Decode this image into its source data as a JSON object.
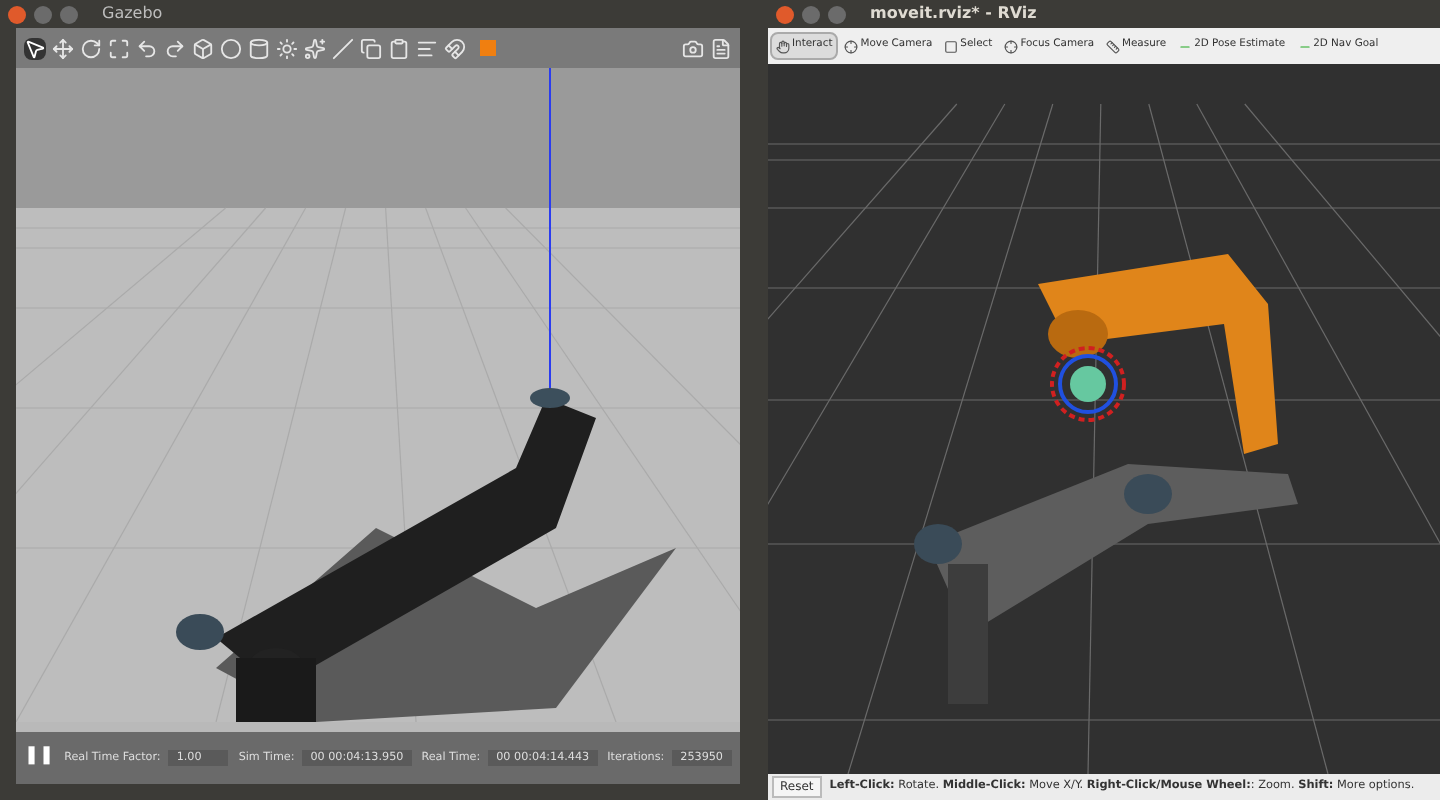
{
  "gazebo": {
    "window": {
      "title": "Gazebo"
    },
    "status_bar": {
      "pause": "❚❚",
      "fields": [
        {
          "label": "Real Time Factor:",
          "value": "1.00"
        },
        {
          "label": "Sim Time:",
          "value": "00 00:04:13.950"
        },
        {
          "label": "Real Time:",
          "value": "00 00:04:14.443"
        },
        {
          "label": "Iterations:",
          "value": "253950"
        }
      ]
    }
  },
  "rviz": {
    "window": {
      "title": "moveit.rviz* - RViz"
    },
    "tools": [
      {
        "label": "Interact",
        "selected": true
      },
      {
        "label": "Move Camera",
        "selected": false
      },
      {
        "label": "Select",
        "selected": false
      },
      {
        "label": "Focus Camera",
        "selected": false
      },
      {
        "label": "Measure",
        "selected": false
      },
      {
        "label": "2D Pose Estimate",
        "selected": false
      },
      {
        "label": "2D Nav Goal",
        "selected": false
      }
    ],
    "status_bar": {
      "reset": "Reset",
      "hint": "**Left-Click:** Rotate. **Middle-Click:** Move X/Y. **Right-Click/Mouse Wheel:**: Zoom. **Shift:** More options."
    }
  }
}
